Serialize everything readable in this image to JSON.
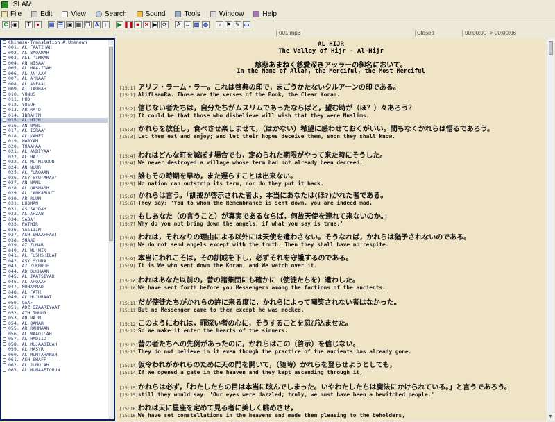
{
  "window": {
    "title": "ISLAM"
  },
  "menu": [
    "File",
    "Edit",
    "View",
    "Search",
    "Sound",
    "Tools",
    "Window",
    "Help"
  ],
  "status": {
    "file": "001.mp3",
    "state": "Closed",
    "time": "00:00:00 -> 00:00:06"
  },
  "sura_list": [
    "Chinese-Translation A:Unknown",
    "001. AL FAATIHAH",
    "002. AL BAQARAH",
    "003. ALI 'IMRAN",
    "004. AN NISAA'",
    "005. AL MAA-IDAH",
    "006. AL AN'AAM",
    "007. AL A'RAAF",
    "008. AL ANFAAL",
    "009. AT TAUBAH",
    "010. YUNUS",
    "011. HUD",
    "012. YUSUF",
    "013. AR RA'D",
    "014. IBRAHIM",
    "015. AL HIJR",
    "016. AN NAHL",
    "017. AL ISRAA'",
    "018. AL KAHFI",
    "019. MARYAM",
    "020. THAAHAA",
    "021. AL ANBIYAA'",
    "022. AL HAJJ",
    "023. AL MU'MINUUN",
    "024. AN NUUR",
    "025. AL FURQAAN",
    "026. ASY SYU'ARAA'",
    "027. AN NAML",
    "028. AL QASHASH",
    "029. AL 'ANKABUUT",
    "030. AR RUUM",
    "031. LUQMAN",
    "032. AS SAJDAH",
    "033. AL AHZAB",
    "034. SABA'",
    "035. FATHIR",
    "036. YASIIIN",
    "037. ASH SHAAFFAAT",
    "038. SHAAD",
    "039. AZ ZUMAR",
    "040. AL MU'MIN",
    "041. AL FUSHSHILAT",
    "042. ASY SYURA",
    "043. AZ ZUKHRUF",
    "044. AD DUKHAAN",
    "045. AL JAATSIYAH",
    "046. AL AHQAAF",
    "047. MUHAMMAD",
    "048. AL FATH",
    "049. AL HUJURAAT",
    "050. QAAF",
    "051. ADZ DZAARIYAAT",
    "052. ATH THUUR",
    "053. AN NAJM",
    "054. AL QAMAR",
    "055. AR RAHMAAN",
    "056. AL WAAQI'AH",
    "057. AL HADIID",
    "058. AL MUJAADILAH",
    "059. AL HASYR",
    "060. AL MUMTAHANAH",
    "061. ASH SHAFF",
    "062. AL JUMU'AH",
    "063. AL MUNAAFIQUUN"
  ],
  "selected_index": 15,
  "reader": {
    "sura_name": "AL HIJR",
    "sura_subtitle": "The Valley of Hijr - Al-Hijr",
    "basmala_jp": "慈悲あまねく慈愛深きアッラーの御名において。",
    "basmala_en": "In the Name of Allah, the Merciful, the Most Merciful",
    "verses": [
      {
        "n1": "[15:1]",
        "jp": "アリフ・ラーム・ラー。これは啓典の印で，まごうかたないクルアーンの印である。",
        "n2": "[15:1]",
        "en": "AlifLaamRa. Those are the verses of the Book, the Clear Koran."
      },
      {
        "n1": "[15:2]",
        "jp": "信じない者たちは，自分たちがムスリムであったならばと，望む時が（ほ？）々あろう？",
        "n2": "[15:2]",
        "en": "It could be that those who disbelieve will wish that they were Muslims."
      },
      {
        "n1": "[15:3]",
        "jp": "かれらを放任し，食べさせ楽しませて，（はかない）希望に惑わせておくがいい。間もなくかれらは悟るであろう。",
        "n2": "[15:3]",
        "en": "Let them eat and enjoy; and let their hopes deceive them, soon they shall know."
      },
      {
        "n1": "[15:4]",
        "jp": "われはどんな町を滅ぼす場合でも，定められた期限がやって来た時にそうした。",
        "n2": "[15:4]",
        "en": "We never destroyed a village whose term had not already been decreed."
      },
      {
        "n1": "[15:5]",
        "jp": "誰もその時期を早め，また遅らすことは出来ない。",
        "n2": "[15:5]",
        "en": "No nation can outstrip its term, nor do they put it back."
      },
      {
        "n1": "[15:6]",
        "jp": "かれらは言う。「訓戒が啓示された者よ，本当にあなたは(ほ?)かれた者である。",
        "n2": "[15:6]",
        "en": "They say: 'You to whom the Remembrance is sent down, you are indeed mad."
      },
      {
        "n1": "[15:7]",
        "jp": "もしあなた（の言うこと）が真実であるならば，何故天使を連れて来ないのか。」",
        "n2": "[15:7]",
        "en": "Why do you not bring down the angels, if what you say is true.'"
      },
      {
        "n1": "[15:8]",
        "jp": "われは，それなりの理由による以外には天使を遣わさない。そうなれば，かれらは猶予されないのである。",
        "n2": "[15:8]",
        "en": "We do not send angels except with the truth. Then they shall have no respite."
      },
      {
        "n1": "[15:9]",
        "jp": "本当にわれこそは，その訓戒を下し，必ずそれを守護するのである。",
        "n2": "[15:9]",
        "en": "It is We who sent down the Koran, and We watch over it."
      },
      {
        "n1": "[15:10]",
        "jp": "われはあなた以前の，昔の諸集団にも確かに（使徒たちを）遣わした。",
        "n2": "[15:10]",
        "en": "We have sent forth before you Messengers among the factions of the ancients."
      },
      {
        "n1": "[15:11]",
        "jp": "だが使徒たちがかれらの許に来る度に，かれらによって嘲笑されない者はなかった。",
        "n2": "[15:11]",
        "en": "But no Messenger came to them except he was mocked."
      },
      {
        "n1": "[15:12]",
        "jp": "このようにわれは，罪深い者の心に，そうすることを忍び込ませた。",
        "n2": "[15:12]",
        "en": "So We make it enter the hearts of the sinners."
      },
      {
        "n1": "[15:13]",
        "jp": "昔の者たちへの先例があったのに，かれらはこの（啓示）を信じない。",
        "n2": "[15:13]",
        "en": "They do not believe in it even though the practice of  the ancients has already gone."
      },
      {
        "n1": "[15:14]",
        "jp": "仮令われがかれらのために天の門を開いて，（随時）かれらを登らせようとしても，",
        "n2": "[15:14]",
        "en": "If We opened a gate in the heaven and they kept ascending through it,"
      },
      {
        "n1": "[15:15]",
        "jp": "かれらは必ず，「わたしたちの目は本当に眩んでしまった。いやわたしたちは魔法にかけられている。」と言うであろう。",
        "n2": "[15:15]",
        "en": "still they would say: 'Our eyes were dazzled; truly, we must have been a bewitched people.'"
      },
      {
        "n1": "[15:16]",
        "jp": "われは天に星座を定めて見る者に美しく眺めさせ，",
        "n2": "[15:16]",
        "en": "We have set constellations in the heavens and made them pleasing to the beholders,"
      }
    ]
  }
}
